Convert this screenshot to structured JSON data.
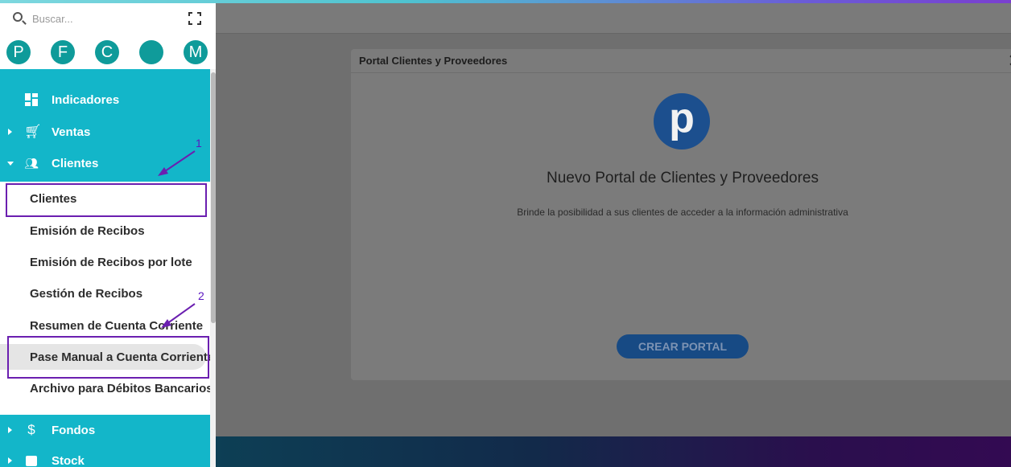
{
  "search": {
    "placeholder": "Buscar..."
  },
  "avatars": [
    "P",
    "F",
    "C",
    "",
    "M"
  ],
  "nav": {
    "indicadores": "Indicadores",
    "ventas": "Ventas",
    "clientes": "Clientes",
    "fondos": "Fondos",
    "stock": "Stock"
  },
  "clientes_submenu": [
    "Clientes",
    "Emisión de Recibos",
    "Emisión de Recibos por lote",
    "Gestión de Recibos",
    "Resumen de Cuenta Corriente",
    "Pase Manual a Cuenta Corriente",
    "Archivo para Débitos Bancarios"
  ],
  "modal": {
    "title": "Portal Clientes y Proveedores",
    "close": "✕",
    "logo_letter": "p",
    "heading": "Nuevo Portal de Clientes y Proveedores",
    "subtitle": "Brinde la posibilidad a sus clientes de acceder a la información administrativa",
    "button": "CREAR PORTAL"
  },
  "annotations": {
    "first": "1",
    "second": "2"
  },
  "colors": {
    "sidebar_teal": "#13b6c9",
    "avatar_teal": "#0f9b9a",
    "annotation_purple": "#6b1fb0",
    "portal_blue": "#1c4f8e"
  }
}
